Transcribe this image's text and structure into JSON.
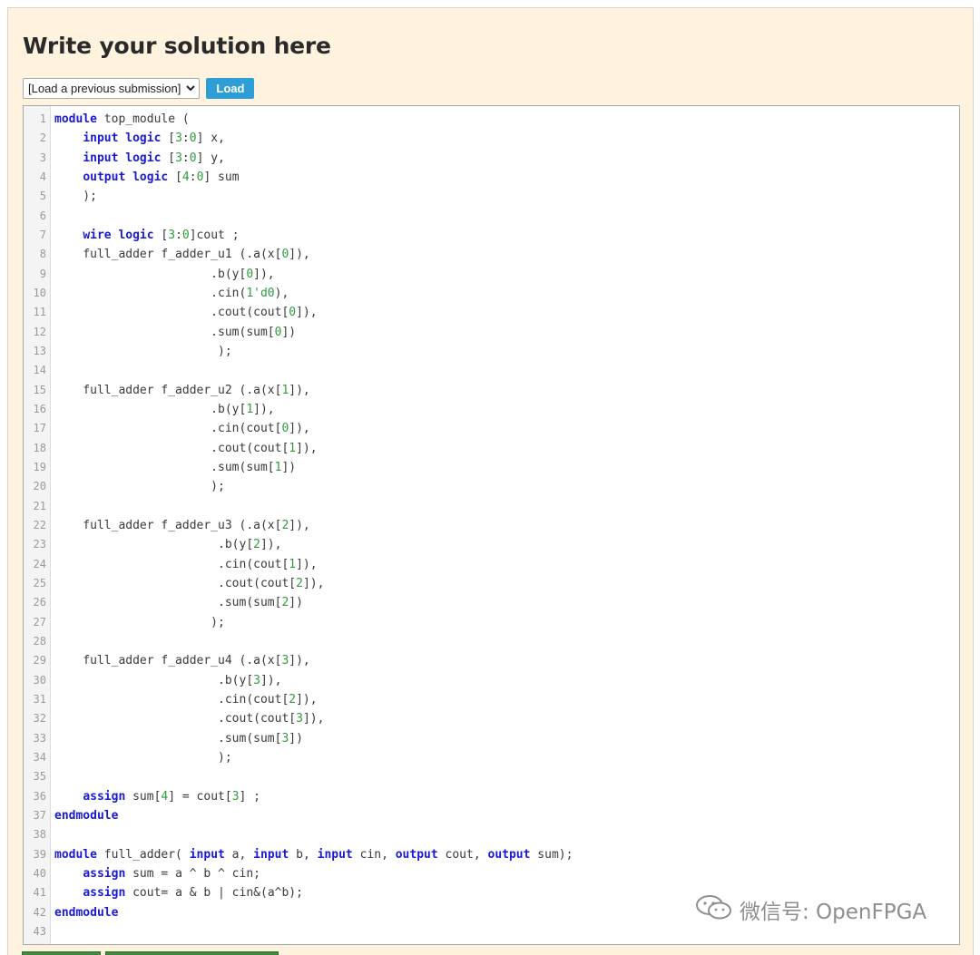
{
  "header": {
    "title": "Write your solution here"
  },
  "controls": {
    "select_value": "[Load a previous submission]",
    "load_label": "Load"
  },
  "editor": {
    "lines": [
      [
        [
          "kw",
          "module"
        ],
        [
          "t",
          " top_module ("
        ]
      ],
      [
        [
          "t",
          "    "
        ],
        [
          "kw",
          "input"
        ],
        [
          "t",
          " "
        ],
        [
          "kw",
          "logic"
        ],
        [
          "t",
          " ["
        ],
        [
          "num",
          "3"
        ],
        [
          "t",
          ":"
        ],
        [
          "num",
          "0"
        ],
        [
          "t",
          "] x,"
        ]
      ],
      [
        [
          "t",
          "    "
        ],
        [
          "kw",
          "input"
        ],
        [
          "t",
          " "
        ],
        [
          "kw",
          "logic"
        ],
        [
          "t",
          " ["
        ],
        [
          "num",
          "3"
        ],
        [
          "t",
          ":"
        ],
        [
          "num",
          "0"
        ],
        [
          "t",
          "] y,"
        ]
      ],
      [
        [
          "t",
          "    "
        ],
        [
          "kw",
          "output"
        ],
        [
          "t",
          " "
        ],
        [
          "kw",
          "logic"
        ],
        [
          "t",
          " ["
        ],
        [
          "num",
          "4"
        ],
        [
          "t",
          ":"
        ],
        [
          "num",
          "0"
        ],
        [
          "t",
          "] sum"
        ]
      ],
      [
        [
          "t",
          "    );"
        ]
      ],
      [
        [
          "t",
          ""
        ]
      ],
      [
        [
          "t",
          "    "
        ],
        [
          "kw",
          "wire"
        ],
        [
          "t",
          " "
        ],
        [
          "kw",
          "logic"
        ],
        [
          "t",
          " ["
        ],
        [
          "num",
          "3"
        ],
        [
          "t",
          ":"
        ],
        [
          "num",
          "0"
        ],
        [
          "t",
          "]cout ;"
        ]
      ],
      [
        [
          "t",
          "    full_adder f_adder_u1 (.a(x["
        ],
        [
          "num",
          "0"
        ],
        [
          "t",
          "]),"
        ]
      ],
      [
        [
          "t",
          "                      .b(y["
        ],
        [
          "num",
          "0"
        ],
        [
          "t",
          "]),"
        ]
      ],
      [
        [
          "t",
          "                      .cin("
        ],
        [
          "num",
          "1'd0"
        ],
        [
          "t",
          "),"
        ]
      ],
      [
        [
          "t",
          "                      .cout(cout["
        ],
        [
          "num",
          "0"
        ],
        [
          "t",
          "]),"
        ]
      ],
      [
        [
          "t",
          "                      .sum(sum["
        ],
        [
          "num",
          "0"
        ],
        [
          "t",
          "])"
        ]
      ],
      [
        [
          "t",
          "                       );"
        ]
      ],
      [
        [
          "t",
          ""
        ]
      ],
      [
        [
          "t",
          "    full_adder f_adder_u2 (.a(x["
        ],
        [
          "num",
          "1"
        ],
        [
          "t",
          "]),"
        ]
      ],
      [
        [
          "t",
          "                      .b(y["
        ],
        [
          "num",
          "1"
        ],
        [
          "t",
          "]),"
        ]
      ],
      [
        [
          "t",
          "                      .cin(cout["
        ],
        [
          "num",
          "0"
        ],
        [
          "t",
          "]),"
        ]
      ],
      [
        [
          "t",
          "                      .cout(cout["
        ],
        [
          "num",
          "1"
        ],
        [
          "t",
          "]),"
        ]
      ],
      [
        [
          "t",
          "                      .sum(sum["
        ],
        [
          "num",
          "1"
        ],
        [
          "t",
          "])"
        ]
      ],
      [
        [
          "t",
          "                      );"
        ]
      ],
      [
        [
          "t",
          ""
        ]
      ],
      [
        [
          "t",
          "    full_adder f_adder_u3 (.a(x["
        ],
        [
          "num",
          "2"
        ],
        [
          "t",
          "]),"
        ]
      ],
      [
        [
          "t",
          "                       .b(y["
        ],
        [
          "num",
          "2"
        ],
        [
          "t",
          "]),"
        ]
      ],
      [
        [
          "t",
          "                       .cin(cout["
        ],
        [
          "num",
          "1"
        ],
        [
          "t",
          "]),"
        ]
      ],
      [
        [
          "t",
          "                       .cout(cout["
        ],
        [
          "num",
          "2"
        ],
        [
          "t",
          "]),"
        ]
      ],
      [
        [
          "t",
          "                       .sum(sum["
        ],
        [
          "num",
          "2"
        ],
        [
          "t",
          "])"
        ]
      ],
      [
        [
          "t",
          "                      );"
        ]
      ],
      [
        [
          "t",
          ""
        ]
      ],
      [
        [
          "t",
          "    full_adder f_adder_u4 (.a(x["
        ],
        [
          "num",
          "3"
        ],
        [
          "t",
          "]),"
        ]
      ],
      [
        [
          "t",
          "                       .b(y["
        ],
        [
          "num",
          "3"
        ],
        [
          "t",
          "]),"
        ]
      ],
      [
        [
          "t",
          "                       .cin(cout["
        ],
        [
          "num",
          "2"
        ],
        [
          "t",
          "]),"
        ]
      ],
      [
        [
          "t",
          "                       .cout(cout["
        ],
        [
          "num",
          "3"
        ],
        [
          "t",
          "]),"
        ]
      ],
      [
        [
          "t",
          "                       .sum(sum["
        ],
        [
          "num",
          "3"
        ],
        [
          "t",
          "])"
        ]
      ],
      [
        [
          "t",
          "                       );"
        ]
      ],
      [
        [
          "t",
          ""
        ]
      ],
      [
        [
          "t",
          "    "
        ],
        [
          "kw",
          "assign"
        ],
        [
          "t",
          " sum["
        ],
        [
          "num",
          "4"
        ],
        [
          "t",
          "] = cout["
        ],
        [
          "num",
          "3"
        ],
        [
          "t",
          "] ;"
        ]
      ],
      [
        [
          "kw",
          "endmodule"
        ]
      ],
      [
        [
          "t",
          ""
        ]
      ],
      [
        [
          "kw",
          "module"
        ],
        [
          "t",
          " full_adder( "
        ],
        [
          "kw",
          "input"
        ],
        [
          "t",
          " a, "
        ],
        [
          "kw",
          "input"
        ],
        [
          "t",
          " b, "
        ],
        [
          "kw",
          "input"
        ],
        [
          "t",
          " cin, "
        ],
        [
          "kw",
          "output"
        ],
        [
          "t",
          " cout, "
        ],
        [
          "kw",
          "output"
        ],
        [
          "t",
          " sum);"
        ]
      ],
      [
        [
          "t",
          "    "
        ],
        [
          "kw",
          "assign"
        ],
        [
          "t",
          " sum = a ^ b ^ cin;"
        ]
      ],
      [
        [
          "t",
          "    "
        ],
        [
          "kw",
          "assign"
        ],
        [
          "t",
          " cout= a & b | cin&(a^b);"
        ]
      ],
      [
        [
          "kw",
          "endmodule"
        ]
      ],
      [
        [
          "t",
          ""
        ]
      ]
    ]
  },
  "watermark": {
    "text": "微信号: OpenFPGA",
    "icon": "wechat-icon"
  },
  "colors": {
    "panel_bg": "#fff3e0",
    "keyword": "#1a1ad6",
    "number": "#2e9c3e",
    "load_button": "#2e9fd6"
  }
}
